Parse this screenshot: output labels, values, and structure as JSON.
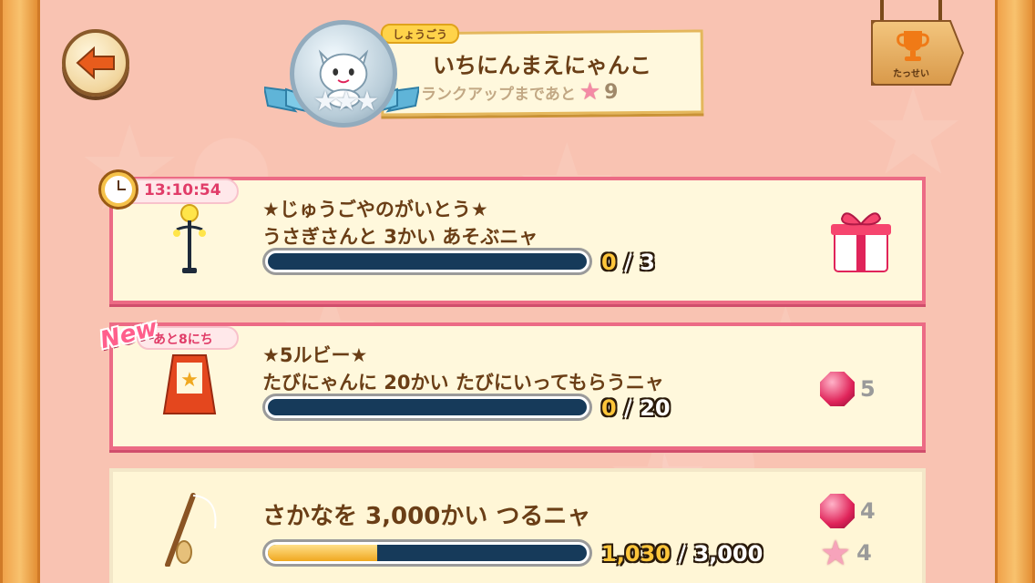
{
  "header": {
    "title_tag": "しょうごう",
    "title": "いちにんまえにゃんこ",
    "rank_up_text": "ランクアップまであと",
    "rank_up_count": "9",
    "achievement_label": "たっせい"
  },
  "missions": [
    {
      "timer": "13:10:54",
      "title": "★じゅうごやのがいとう★",
      "description": "うさぎさんと 3かい あそぶニャ",
      "current": "0",
      "target": "3",
      "progress": 0,
      "reward_icon": "gift-box-icon",
      "item_icon": "street-lamp-icon"
    },
    {
      "badge": "New",
      "days_left": "あと8にち",
      "title": "★5ルビー★",
      "description": "たびにゃんに 20かい たびにいってもらうニャ",
      "current": "0",
      "target": "20",
      "progress": 0,
      "rewards": [
        {
          "icon": "ruby-icon",
          "amount": "5"
        }
      ],
      "item_icon": "easel-sign-icon"
    },
    {
      "title": "さかなを 3,000かい つるニャ",
      "current": "1,030",
      "target": "3,000",
      "progress": 0.343,
      "rewards": [
        {
          "icon": "ruby-icon",
          "amount": "4"
        },
        {
          "icon": "pink-star-icon",
          "amount": "4"
        }
      ],
      "item_icon": "fishing-rod-icon"
    }
  ],
  "colors": {
    "card_border": "#ec6b85",
    "timer_text": "#e13c68",
    "bar_track": "#163a5a",
    "bar_fill": "#f0a820"
  }
}
